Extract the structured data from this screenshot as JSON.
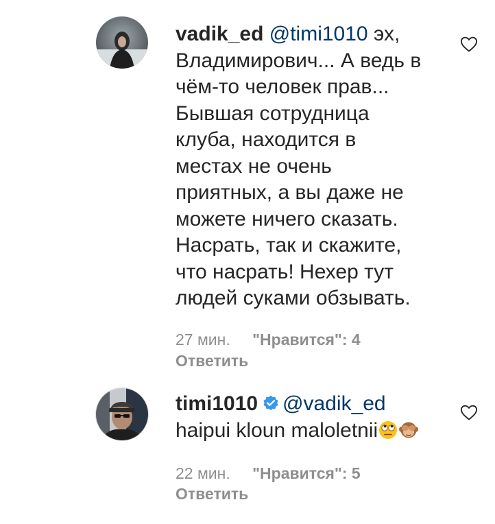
{
  "comments": [
    {
      "username": "vadik_ed",
      "mention": "@timi1010",
      "lines": [
        "эх,",
        "Владимирович... А ведь в",
        "чём-то человек прав...",
        "Бывшая сотрудница",
        "клуба, находится в",
        "местах не очень",
        "приятных, а вы даже не",
        "можете ничего сказать.",
        "Насрать, так и скажите,",
        "что насрать! Нехер тут",
        "людей суками обзывать."
      ],
      "time": "27 мин.",
      "likes": "\"Нравится\": 4",
      "reply": "Ответить",
      "verified": false
    },
    {
      "username": "timi1010",
      "mention": "@vadik_ed",
      "text": "haipui kloun maloletnii",
      "emoji": [
        "rolling-eyes-emoji",
        "see-no-evil-monkey-emoji"
      ],
      "time": "22 мин.",
      "likes": "\"Нравится\": 5",
      "reply": "Ответить",
      "verified": true
    }
  ],
  "colors": {
    "text": "#262626",
    "mention": "#00376b",
    "meta": "#8e8e8e",
    "verified": "#3897f0"
  }
}
